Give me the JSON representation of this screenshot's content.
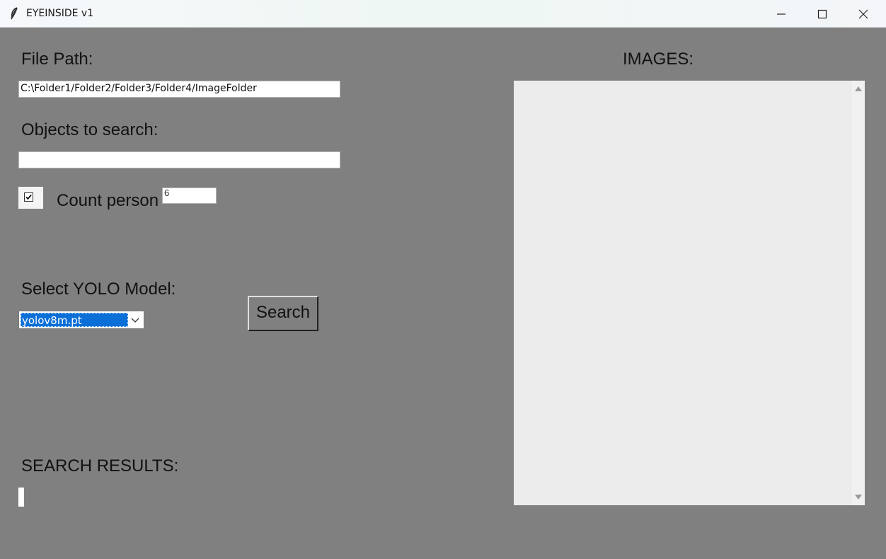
{
  "window": {
    "title": "EYEINSIDE v1",
    "icon": "feather-icon"
  },
  "form": {
    "file_path_label": "File Path:",
    "file_path_value": "C:\\Folder1/Folder2/Folder3/Folder4/ImageFolder",
    "objects_label": "Objects to search:",
    "objects_value": "",
    "count_checkbox_checked": true,
    "count_label": "Count person",
    "count_value": "6",
    "model_label": "Select YOLO Model:",
    "model_selected": "yolov8m.pt",
    "search_button": "Search",
    "results_label": "SEARCH RESULTS:",
    "results_value": ""
  },
  "images_panel": {
    "title": "IMAGES:"
  }
}
